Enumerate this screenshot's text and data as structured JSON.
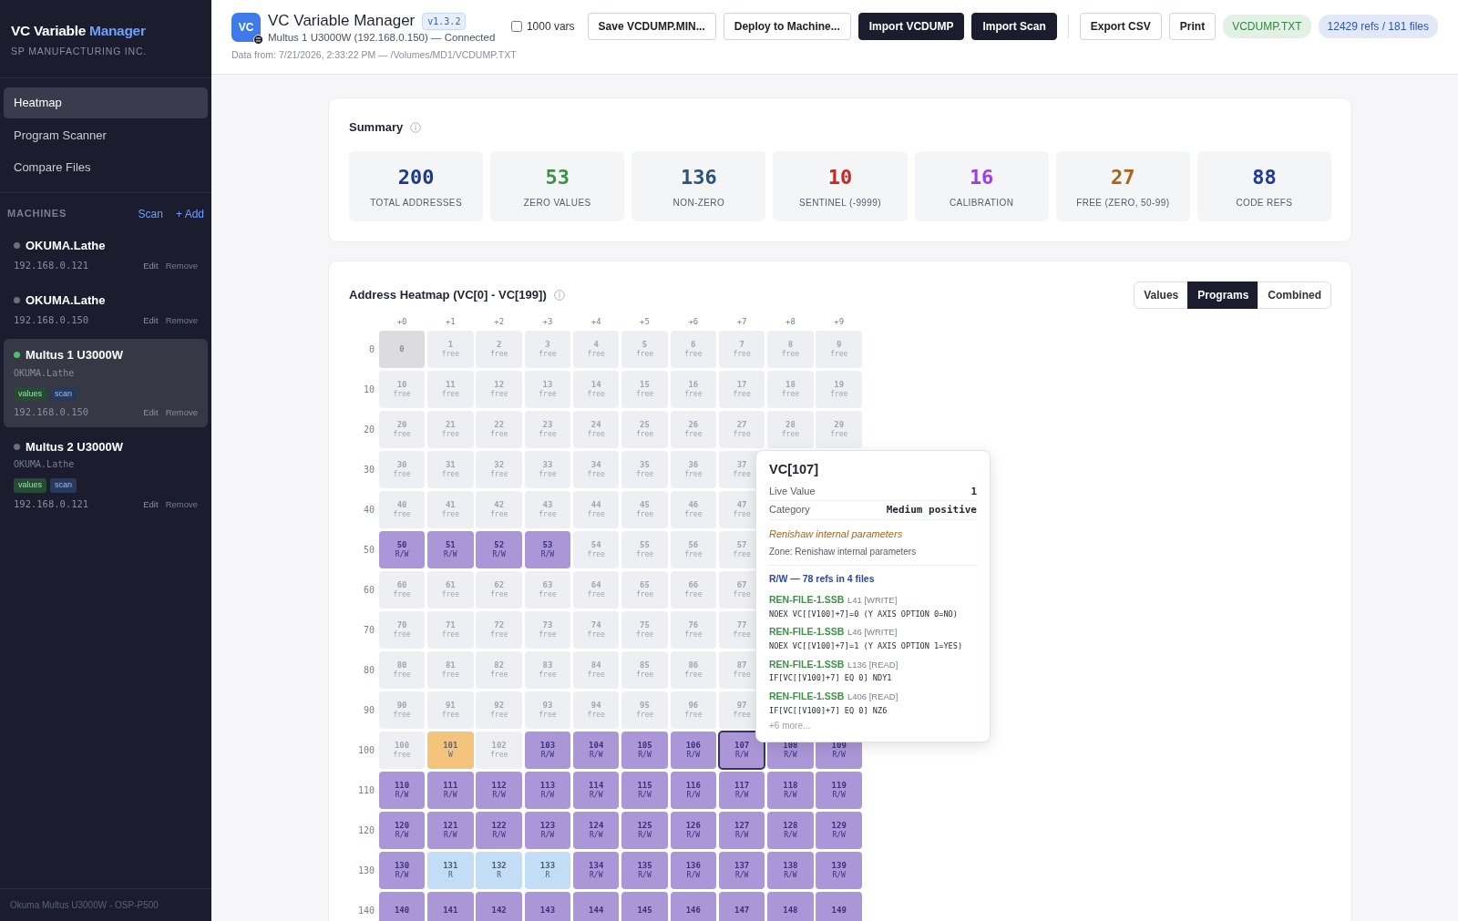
{
  "sidebar": {
    "title": "VC Variable",
    "title_accent": "Manager",
    "company": "SP MANUFACTURING INC.",
    "nav": [
      {
        "label": "Heatmap",
        "selected": true
      },
      {
        "label": "Program Scanner",
        "selected": false
      },
      {
        "label": "Compare Files",
        "selected": false
      }
    ],
    "machines_heading": "MACHINES",
    "scan_link": "Scan",
    "add_link": "+ Add",
    "machines": [
      {
        "name": "OKUMA.Lathe",
        "online": false,
        "ip": "192.168.0.121",
        "edit": "Edit",
        "remove": "Remove",
        "selected": false
      },
      {
        "name": "OKUMA.Lathe",
        "online": false,
        "ip": "192.168.0.150",
        "edit": "Edit",
        "remove": "Remove",
        "selected": false
      },
      {
        "name": "Multus 1 U3000W",
        "online": true,
        "model": "OKUMA.Lathe",
        "tags": [
          {
            "label": "values",
            "kind": "values"
          },
          {
            "label": "scan",
            "kind": "scan"
          }
        ],
        "ip": "192.168.0.150",
        "edit": "Edit",
        "remove": "Remove",
        "selected": true
      },
      {
        "name": "Multus 2 U3000W",
        "online": false,
        "model": "OKUMA.Lathe",
        "tags": [
          {
            "label": "values",
            "kind": "values"
          },
          {
            "label": "scan",
            "kind": "scan"
          }
        ],
        "ip": "192.168.0.121",
        "edit": "Edit",
        "remove": "Remove",
        "selected": false
      }
    ],
    "footer": "Okuma Multus U3000W - OSP-P500"
  },
  "header": {
    "logo_text": "VC",
    "title": "VC Variable Manager",
    "version": "v1.3.2",
    "subtitle": "Multus 1 U3000W (192.168.0.150) — Connected",
    "data_from": "Data from: 7/21/2026, 2:33:22 PM — /Volumes/MD1/VCDUMP.TXT",
    "checkbox": {
      "label": "1000 vars",
      "checked": false
    },
    "buttons": [
      {
        "label": "Save VCDUMP.MIN...",
        "kind": "outline"
      },
      {
        "label": "Deploy to Machine...",
        "kind": "outline"
      },
      {
        "label": "Import VCDUMP",
        "kind": "dark"
      },
      {
        "label": "Import Scan",
        "kind": "dark"
      },
      {
        "label": "Export CSV",
        "kind": "outline"
      },
      {
        "label": "Print",
        "kind": "outline"
      }
    ],
    "pills": [
      {
        "label": "VCDUMP.TXT",
        "color": "#2e8b3e"
      },
      {
        "label": "12429 refs / 181 files",
        "color": "#2b55c4"
      }
    ]
  },
  "summary": {
    "title": "Summary",
    "stats": [
      {
        "value": "200",
        "label": "TOTAL ADDRESSES",
        "color": "#1e3a8a"
      },
      {
        "value": "53",
        "label": "ZERO VALUES",
        "color": "#3d9142"
      },
      {
        "value": "136",
        "label": "NON-ZERO",
        "color": "#2b5478"
      },
      {
        "value": "10",
        "label": "SENTINEL (-9999)",
        "color": "#c62828"
      },
      {
        "value": "16",
        "label": "CALIBRATION",
        "color": "#9b3fe0"
      },
      {
        "value": "27",
        "label": "FREE (ZERO, 50-99)",
        "color": "#a8651a"
      },
      {
        "value": "88",
        "label": "CODE REFS",
        "color": "#1e3a9a"
      }
    ]
  },
  "heatmap": {
    "title": "Address Heatmap (VC[0] - VC[199])",
    "views": [
      {
        "label": "Values",
        "selected": false
      },
      {
        "label": "Programs",
        "selected": true
      },
      {
        "label": "Combined",
        "selected": false
      }
    ],
    "columns": [
      "+0",
      "+1",
      "+2",
      "+3",
      "+4",
      "+5",
      "+6",
      "+7",
      "+8",
      "+9"
    ],
    "rows": [
      {
        "label": "0",
        "cells": [
          {
            "number": "0",
            "kind": "zero",
            "selected": false
          },
          {
            "number": "1",
            "sub": "free",
            "kind": "free",
            "selected": false
          },
          {
            "number": "2",
            "sub": "free",
            "kind": "free",
            "selected": false
          },
          {
            "number": "3",
            "sub": "free",
            "kind": "free",
            "selected": false
          },
          {
            "number": "4",
            "sub": "free",
            "kind": "free",
            "selected": false
          },
          {
            "number": "5",
            "sub": "free",
            "kind": "free",
            "selected": false
          },
          {
            "number": "6",
            "sub": "free",
            "kind": "free",
            "selected": false
          },
          {
            "number": "7",
            "sub": "free",
            "kind": "free",
            "selected": false
          },
          {
            "number": "8",
            "sub": "free",
            "kind": "free",
            "selected": false
          },
          {
            "number": "9",
            "sub": "free",
            "kind": "free",
            "selected": false
          }
        ]
      },
      {
        "label": "10",
        "cells": [
          {
            "number": "10",
            "sub": "free",
            "kind": "free",
            "selected": false
          },
          {
            "number": "11",
            "sub": "free",
            "kind": "free",
            "selected": false
          },
          {
            "number": "12",
            "sub": "free",
            "kind": "free",
            "selected": false
          },
          {
            "number": "13",
            "sub": "free",
            "kind": "free",
            "selected": false
          },
          {
            "number": "14",
            "sub": "free",
            "kind": "free",
            "selected": false
          },
          {
            "number": "15",
            "sub": "free",
            "kind": "free",
            "selected": false
          },
          {
            "number": "16",
            "sub": "free",
            "kind": "free",
            "selected": false
          },
          {
            "number": "17",
            "sub": "free",
            "kind": "free",
            "selected": false
          },
          {
            "number": "18",
            "sub": "free",
            "kind": "free",
            "selected": false
          },
          {
            "number": "19",
            "sub": "free",
            "kind": "free",
            "selected": false
          }
        ]
      },
      {
        "label": "20",
        "cells": [
          {
            "number": "20",
            "sub": "free",
            "kind": "free",
            "selected": false
          },
          {
            "number": "21",
            "sub": "free",
            "kind": "free",
            "selected": false
          },
          {
            "number": "22",
            "sub": "free",
            "kind": "free",
            "selected": false
          },
          {
            "number": "23",
            "sub": "free",
            "kind": "free",
            "selected": false
          },
          {
            "number": "24",
            "sub": "free",
            "kind": "free",
            "selected": false
          },
          {
            "number": "25",
            "sub": "free",
            "kind": "free",
            "selected": false
          },
          {
            "number": "26",
            "sub": "free",
            "kind": "free",
            "selected": false
          },
          {
            "number": "27",
            "sub": "free",
            "kind": "free",
            "selected": false
          },
          {
            "number": "28",
            "sub": "free",
            "kind": "free",
            "selected": false
          },
          {
            "number": "29",
            "sub": "free",
            "kind": "free",
            "selected": false
          }
        ]
      },
      {
        "label": "30",
        "cells": [
          {
            "number": "30",
            "sub": "free",
            "kind": "free",
            "selected": false
          },
          {
            "number": "31",
            "sub": "free",
            "kind": "free",
            "selected": false
          },
          {
            "number": "32",
            "sub": "free",
            "kind": "free",
            "selected": false
          },
          {
            "number": "33",
            "sub": "free",
            "kind": "free",
            "selected": false
          },
          {
            "number": "34",
            "sub": "free",
            "kind": "free",
            "selected": false
          },
          {
            "number": "35",
            "sub": "free",
            "kind": "free",
            "selected": false
          },
          {
            "number": "36",
            "sub": "free",
            "kind": "free",
            "selected": false
          },
          {
            "number": "37",
            "sub": "free",
            "kind": "free",
            "selected": false
          }
        ]
      },
      {
        "label": "40",
        "cells": [
          {
            "number": "40",
            "sub": "free",
            "kind": "free",
            "selected": false
          },
          {
            "number": "41",
            "sub": "free",
            "kind": "free",
            "selected": false
          },
          {
            "number": "42",
            "sub": "free",
            "kind": "free",
            "selected": false
          },
          {
            "number": "43",
            "sub": "free",
            "kind": "free",
            "selected": false
          },
          {
            "number": "44",
            "sub": "free",
            "kind": "free",
            "selected": false
          },
          {
            "number": "45",
            "sub": "free",
            "kind": "free",
            "selected": false
          },
          {
            "number": "46",
            "sub": "free",
            "kind": "free",
            "selected": false
          },
          {
            "number": "47",
            "sub": "free",
            "kind": "free",
            "selected": false
          }
        ]
      },
      {
        "label": "50",
        "cells": [
          {
            "number": "50",
            "sub": "R/W",
            "kind": "rw",
            "selected": false
          },
          {
            "number": "51",
            "sub": "R/W",
            "kind": "rw",
            "selected": false
          },
          {
            "number": "52",
            "sub": "R/W",
            "kind": "rw",
            "selected": false
          },
          {
            "number": "53",
            "sub": "R/W",
            "kind": "rw",
            "selected": false
          },
          {
            "number": "54",
            "sub": "free",
            "kind": "free",
            "selected": false
          },
          {
            "number": "55",
            "sub": "free",
            "kind": "free",
            "selected": false
          },
          {
            "number": "56",
            "sub": "free",
            "kind": "free",
            "selected": false
          },
          {
            "number": "57",
            "sub": "free",
            "kind": "free",
            "selected": false
          }
        ]
      },
      {
        "label": "60",
        "cells": [
          {
            "number": "60",
            "sub": "free",
            "kind": "free",
            "selected": false
          },
          {
            "number": "61",
            "sub": "free",
            "kind": "free",
            "selected": false
          },
          {
            "number": "62",
            "sub": "free",
            "kind": "free",
            "selected": false
          },
          {
            "number": "63",
            "sub": "free",
            "kind": "free",
            "selected": false
          },
          {
            "number": "64",
            "sub": "free",
            "kind": "free",
            "selected": false
          },
          {
            "number": "65",
            "sub": "free",
            "kind": "free",
            "selected": false
          },
          {
            "number": "66",
            "sub": "free",
            "kind": "free",
            "selected": false
          },
          {
            "number": "67",
            "sub": "free",
            "kind": "free",
            "selected": false
          }
        ]
      },
      {
        "label": "70",
        "cells": [
          {
            "number": "70",
            "sub": "free",
            "kind": "free",
            "selected": false
          },
          {
            "number": "71",
            "sub": "free",
            "kind": "free",
            "selected": false
          },
          {
            "number": "72",
            "sub": "free",
            "kind": "free",
            "selected": false
          },
          {
            "number": "73",
            "sub": "free",
            "kind": "free",
            "selected": false
          },
          {
            "number": "74",
            "sub": "free",
            "kind": "free",
            "selected": false
          },
          {
            "number": "75",
            "sub": "free",
            "kind": "free",
            "selected": false
          },
          {
            "number": "76",
            "sub": "free",
            "kind": "free",
            "selected": false
          },
          {
            "number": "77",
            "sub": "free",
            "kind": "free",
            "selected": false
          }
        ]
      },
      {
        "label": "80",
        "cells": [
          {
            "number": "80",
            "sub": "free",
            "kind": "free",
            "selected": false
          },
          {
            "number": "81",
            "sub": "free",
            "kind": "free",
            "selected": false
          },
          {
            "number": "82",
            "sub": "free",
            "kind": "free",
            "selected": false
          },
          {
            "number": "83",
            "sub": "free",
            "kind": "free",
            "selected": false
          },
          {
            "number": "84",
            "sub": "free",
            "kind": "free",
            "selected": false
          },
          {
            "number": "85",
            "sub": "free",
            "kind": "free",
            "selected": false
          },
          {
            "number": "86",
            "sub": "free",
            "kind": "free",
            "selected": false
          },
          {
            "number": "87",
            "sub": "free",
            "kind": "free",
            "selected": false
          }
        ]
      },
      {
        "label": "90",
        "cells": [
          {
            "number": "90",
            "sub": "free",
            "kind": "free",
            "selected": false
          },
          {
            "number": "91",
            "sub": "free",
            "kind": "free",
            "selected": false
          },
          {
            "number": "92",
            "sub": "free",
            "kind": "free",
            "selected": false
          },
          {
            "number": "93",
            "sub": "free",
            "kind": "free",
            "selected": false
          },
          {
            "number": "94",
            "sub": "free",
            "kind": "free",
            "selected": false
          },
          {
            "number": "95",
            "sub": "free",
            "kind": "free",
            "selected": false
          },
          {
            "number": "96",
            "sub": "free",
            "kind": "free",
            "selected": false
          },
          {
            "number": "97",
            "sub": "free",
            "kind": "free",
            "selected": false
          }
        ]
      },
      {
        "label": "100",
        "cells": [
          {
            "number": "100",
            "sub": "free",
            "kind": "free",
            "selected": false
          },
          {
            "number": "101",
            "sub": "W",
            "kind": "w",
            "selected": false
          },
          {
            "number": "102",
            "sub": "free",
            "kind": "free",
            "selected": false
          },
          {
            "number": "103",
            "sub": "R/W",
            "kind": "rw",
            "selected": false
          },
          {
            "number": "104",
            "sub": "R/W",
            "kind": "rw",
            "selected": false
          },
          {
            "number": "105",
            "sub": "R/W",
            "kind": "rw",
            "selected": false
          },
          {
            "number": "106",
            "sub": "R/W",
            "kind": "rw",
            "selected": false
          },
          {
            "number": "107",
            "sub": "R/W",
            "kind": "rw",
            "selected": true
          },
          {
            "number": "108",
            "sub": "R/W",
            "kind": "rw",
            "selected": false
          },
          {
            "number": "109",
            "sub": "R/W",
            "kind": "rw",
            "selected": false
          }
        ]
      },
      {
        "label": "110",
        "cells": [
          {
            "number": "110",
            "sub": "R/W",
            "kind": "rw",
            "selected": false
          },
          {
            "number": "111",
            "sub": "R/W",
            "kind": "rw",
            "selected": false
          },
          {
            "number": "112",
            "sub": "R/W",
            "kind": "rw",
            "selected": false
          },
          {
            "number": "113",
            "sub": "R/W",
            "kind": "rw",
            "selected": false
          },
          {
            "number": "114",
            "sub": "R/W",
            "kind": "rw",
            "selected": false
          },
          {
            "number": "115",
            "sub": "R/W",
            "kind": "rw",
            "selected": false
          },
          {
            "number": "116",
            "sub": "R/W",
            "kind": "rw",
            "selected": false
          },
          {
            "number": "117",
            "sub": "R/W",
            "kind": "rw",
            "selected": false
          },
          {
            "number": "118",
            "sub": "R/W",
            "kind": "rw",
            "selected": false
          },
          {
            "number": "119",
            "sub": "R/W",
            "kind": "rw",
            "selected": false
          }
        ]
      },
      {
        "label": "120",
        "cells": [
          {
            "number": "120",
            "sub": "R/W",
            "kind": "rw",
            "selected": false
          },
          {
            "number": "121",
            "sub": "R/W",
            "kind": "rw",
            "selected": false
          },
          {
            "number": "122",
            "sub": "R/W",
            "kind": "rw",
            "selected": false
          },
          {
            "number": "123",
            "sub": "R/W",
            "kind": "rw",
            "selected": false
          },
          {
            "number": "124",
            "sub": "R/W",
            "kind": "rw",
            "selected": false
          },
          {
            "number": "125",
            "sub": "R/W",
            "kind": "rw",
            "selected": false
          },
          {
            "number": "126",
            "sub": "R/W",
            "kind": "rw",
            "selected": false
          },
          {
            "number": "127",
            "sub": "R/W",
            "kind": "rw",
            "selected": false
          },
          {
            "number": "128",
            "sub": "R/W",
            "kind": "rw",
            "selected": false
          },
          {
            "number": "129",
            "sub": "R/W",
            "kind": "rw",
            "selected": false
          }
        ]
      },
      {
        "label": "130",
        "cells": [
          {
            "number": "130",
            "sub": "R/W",
            "kind": "rw",
            "selected": false
          },
          {
            "number": "131",
            "sub": "R",
            "kind": "r",
            "selected": false
          },
          {
            "number": "132",
            "sub": "R",
            "kind": "r",
            "selected": false
          },
          {
            "number": "133",
            "sub": "R",
            "kind": "r",
            "selected": false
          },
          {
            "number": "134",
            "sub": "R/W",
            "kind": "rw",
            "selected": false
          },
          {
            "number": "135",
            "sub": "R/W",
            "kind": "rw",
            "selected": false
          },
          {
            "number": "136",
            "sub": "R/W",
            "kind": "rw",
            "selected": false
          },
          {
            "number": "137",
            "sub": "R/W",
            "kind": "rw",
            "selected": false
          },
          {
            "number": "138",
            "sub": "R/W",
            "kind": "rw",
            "selected": false
          },
          {
            "number": "139",
            "sub": "R/W",
            "kind": "rw",
            "selected": false
          }
        ]
      },
      {
        "label": "140",
        "cells": [
          {
            "number": "140",
            "kind": "rw",
            "selected": false
          },
          {
            "number": "141",
            "kind": "rw",
            "selected": false
          },
          {
            "number": "142",
            "kind": "rw",
            "selected": false
          },
          {
            "number": "143",
            "kind": "rw",
            "selected": false
          },
          {
            "number": "144",
            "kind": "rw",
            "selected": false
          },
          {
            "number": "145",
            "kind": "rw",
            "selected": false
          },
          {
            "number": "146",
            "kind": "rw",
            "selected": false
          },
          {
            "number": "147",
            "kind": "rw",
            "selected": false
          },
          {
            "number": "148",
            "kind": "rw",
            "selected": false
          },
          {
            "number": "149",
            "kind": "rw",
            "selected": false
          }
        ]
      }
    ],
    "tooltip": {
      "title": "VC[107]",
      "fields": [
        {
          "label": "Live Value",
          "value": "1"
        },
        {
          "label": "Category",
          "value": "Medium positive"
        }
      ],
      "zone_name": "Renishaw internal parameters",
      "zone": "Zone: Renishaw internal parameters",
      "refs_heading": "R/W — 78 refs in 4 files",
      "refs": [
        {
          "file": "REN-FILE-1.SSB",
          "line": "L41 [WRITE]",
          "code": "NOEX VC[[V100]+7]=0 (Y AXIS OPTION 0=NO)"
        },
        {
          "file": "REN-FILE-1.SSB",
          "line": "L46 [WRITE]",
          "code": "NOEX VC[[V100]+7]=1 (Y AXIS OPTION 1=YES)"
        },
        {
          "file": "REN-FILE-1.SSB",
          "line": "L136 [READ]",
          "code": "IF[VC[[V100]+7] EQ 0] NDY1"
        },
        {
          "file": "REN-FILE-1.SSB",
          "line": "L406 [READ]",
          "code": "IF[VC[[V100]+7] EQ 0] NZ6"
        }
      ],
      "more": "+6 more..."
    }
  }
}
